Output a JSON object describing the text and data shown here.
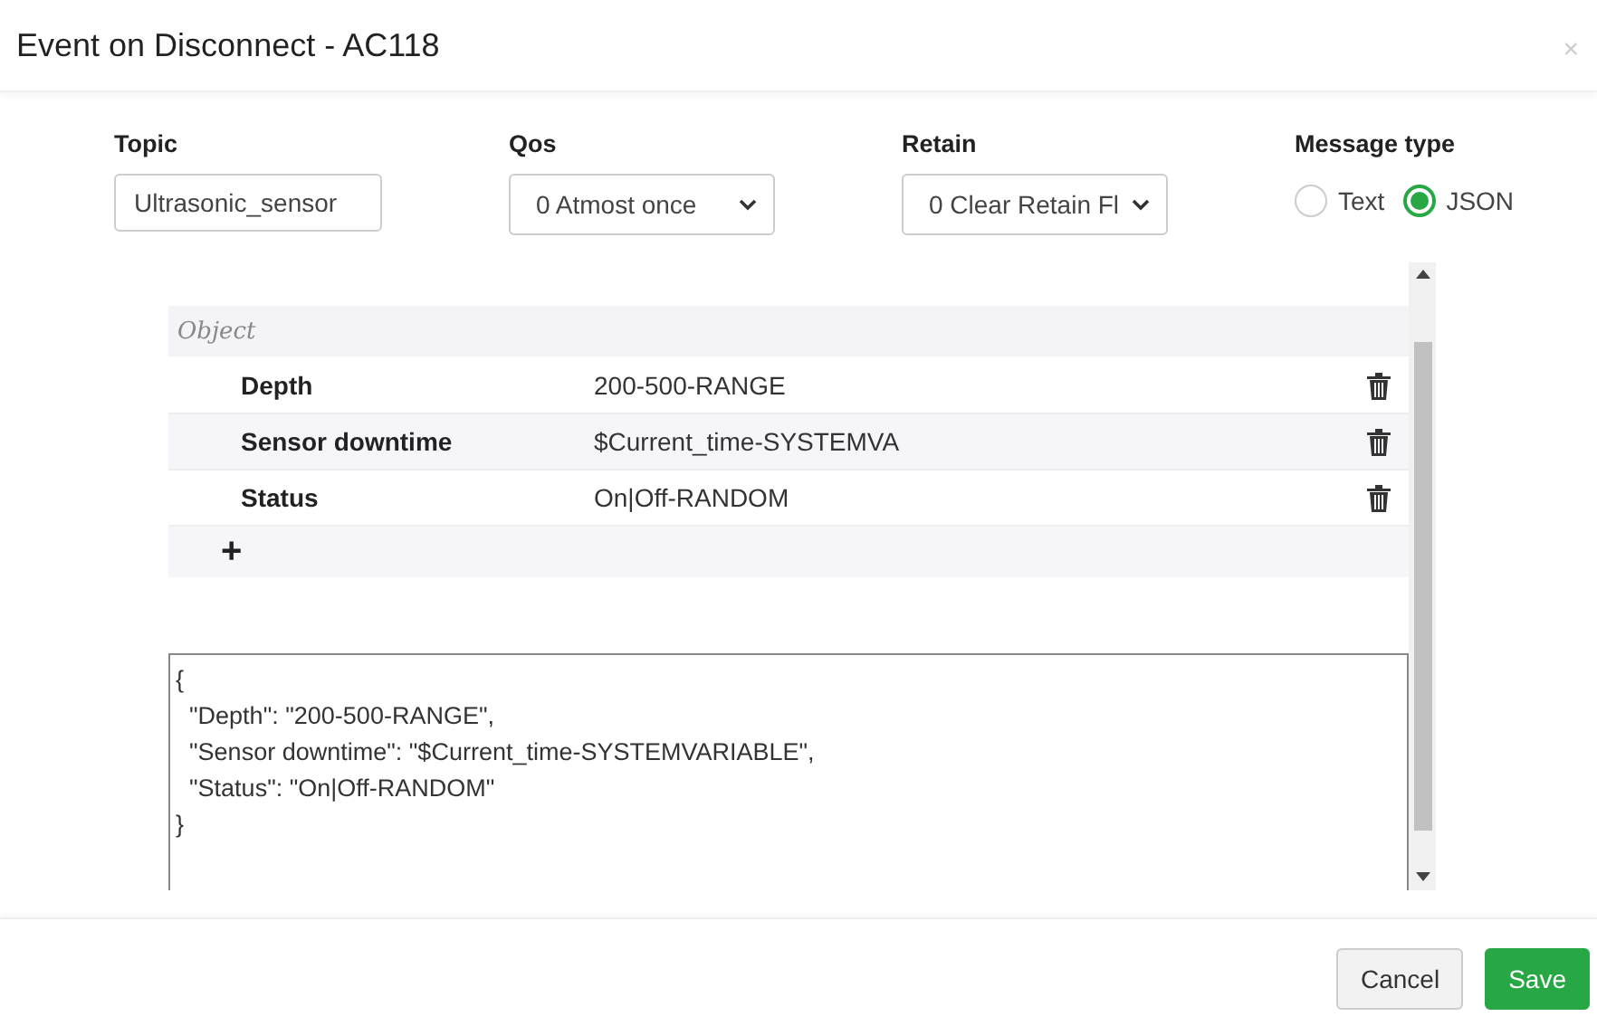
{
  "window": {
    "title": "Event on Disconnect - AC118",
    "close": "×"
  },
  "form": {
    "topic": {
      "label": "Topic",
      "value": "Ultrasonic_sensor"
    },
    "qos": {
      "label": "Qos",
      "value": "0 Atmost once"
    },
    "retain": {
      "label": "Retain",
      "value": "0 Clear Retain Fl"
    },
    "message_type": {
      "label": "Message type",
      "options": [
        {
          "label": "Text",
          "selected": false
        },
        {
          "label": "JSON",
          "selected": true
        }
      ]
    }
  },
  "object_table": {
    "header": "Object",
    "rows": [
      {
        "key": "Depth",
        "value": "200-500-RANGE"
      },
      {
        "key": "Sensor downtime",
        "value": "$Current_time-SYSTEMVA"
      },
      {
        "key": "Status",
        "value": "On|Off-RANDOM"
      }
    ],
    "add": "+"
  },
  "json_text": "{\n  \"Depth\": \"200-500-RANGE\",\n  \"Sensor downtime\": \"$Current_time-SYSTEMVARIABLE\",\n  \"Status\": \"On|Off-RANDOM\"\n}",
  "buttons": [
    {
      "label": "Cancel",
      "kind": "secondary"
    },
    {
      "label": "Save",
      "kind": "primary"
    }
  ]
}
